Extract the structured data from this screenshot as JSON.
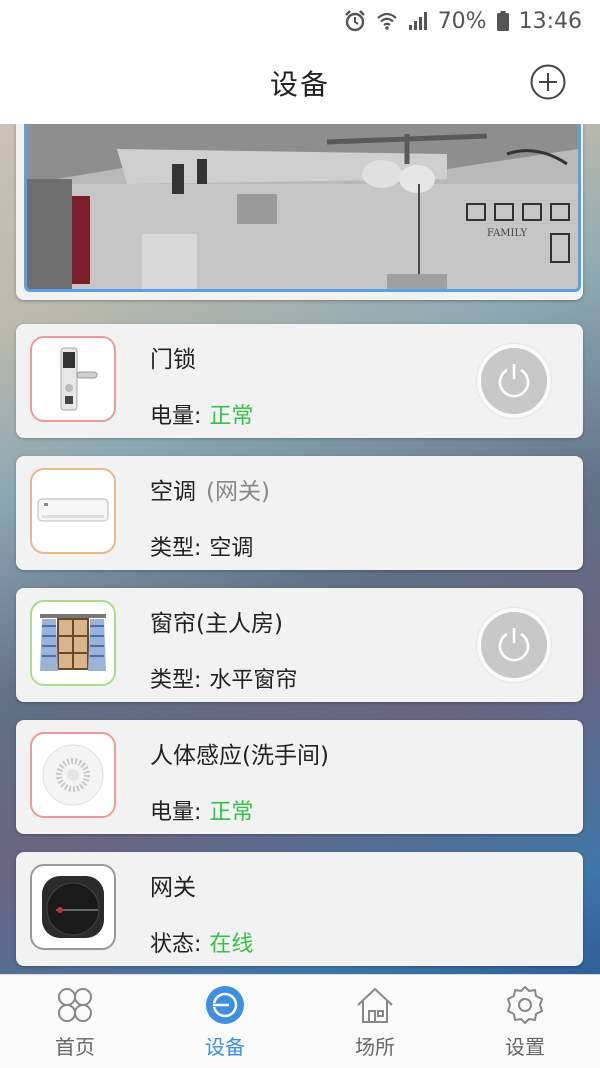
{
  "status_bar": {
    "battery": "70%",
    "time": "13:46"
  },
  "header": {
    "title": "设备"
  },
  "devices": [
    {
      "name": "门锁",
      "sub": "",
      "info_label": "电量:",
      "info_value": "正常",
      "value_color": "#35c24a",
      "border": "#ee9a9a",
      "has_power": true
    },
    {
      "name": "空调",
      "sub": "(网关)",
      "info_label": "类型:",
      "info_value": "空调",
      "value_color": "#222222",
      "border": "#e8b88a",
      "has_power": false
    },
    {
      "name": "窗帘(主人房)",
      "sub": "",
      "info_label": "类型:",
      "info_value": "水平窗帘",
      "value_color": "#222222",
      "border": "#a9dd8c",
      "has_power": true
    },
    {
      "name": "人体感应(洗手间)",
      "sub": "",
      "info_label": "电量:",
      "info_value": "正常",
      "value_color": "#35c24a",
      "border": "#ee9a9a",
      "has_power": false
    },
    {
      "name": "网关",
      "sub": "",
      "info_label": "状态:",
      "info_value": "在线",
      "value_color": "#35c24a",
      "border": "#999999",
      "has_power": false
    }
  ],
  "tabs": [
    {
      "label": "首页",
      "icon": "home-grid-icon",
      "active": false
    },
    {
      "label": "设备",
      "icon": "device-icon",
      "active": true
    },
    {
      "label": "场所",
      "icon": "house-icon",
      "active": false
    },
    {
      "label": "设置",
      "icon": "gear-icon",
      "active": false
    }
  ]
}
